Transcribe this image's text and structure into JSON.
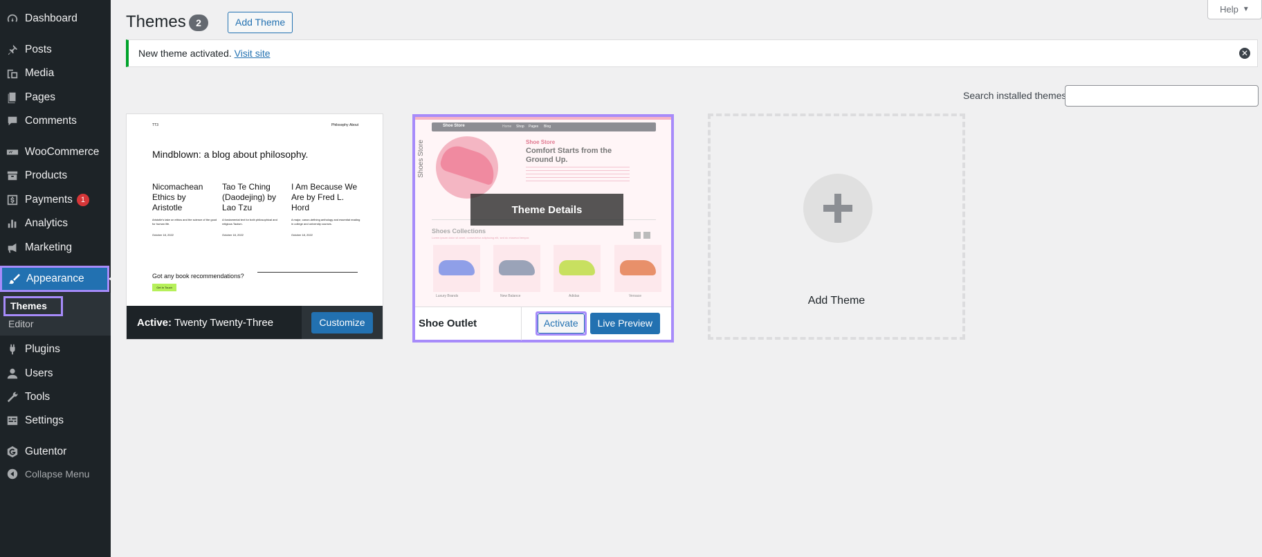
{
  "sidebar": {
    "items": [
      {
        "label": "Dashboard",
        "icon": "dashboard-icon"
      },
      {
        "label": "Posts",
        "icon": "pin-icon"
      },
      {
        "label": "Media",
        "icon": "media-icon"
      },
      {
        "label": "Pages",
        "icon": "pages-icon"
      },
      {
        "label": "Comments",
        "icon": "comment-icon"
      },
      {
        "label": "WooCommerce",
        "icon": "woo-icon"
      },
      {
        "label": "Products",
        "icon": "archive-icon"
      },
      {
        "label": "Payments",
        "icon": "dollar-icon",
        "badge": "1"
      },
      {
        "label": "Analytics",
        "icon": "bar-chart-icon"
      },
      {
        "label": "Marketing",
        "icon": "megaphone-icon"
      },
      {
        "label": "Appearance",
        "icon": "brush-icon"
      },
      {
        "label": "Plugins",
        "icon": "plug-icon"
      },
      {
        "label": "Users",
        "icon": "user-icon"
      },
      {
        "label": "Tools",
        "icon": "wrench-icon"
      },
      {
        "label": "Settings",
        "icon": "settings-icon"
      },
      {
        "label": "Gutentor",
        "icon": "gutentor-icon"
      }
    ],
    "submenu": [
      "Themes",
      "Editor"
    ],
    "collapse_label": "Collapse Menu"
  },
  "header": {
    "title": "Themes",
    "count": "2",
    "add_theme_label": "Add Theme",
    "help_label": "Help"
  },
  "notice": {
    "text": "New theme activated.",
    "link": "Visit site"
  },
  "search": {
    "label": "Search installed themes",
    "value": ""
  },
  "themes": {
    "active": {
      "prefix": "Active:",
      "name": "Twenty Twenty-Three",
      "button": "Customize",
      "preview": {
        "logo": "TT3",
        "nav": [
          "Philosophy",
          "About"
        ],
        "headline": "Mindblown: a blog about philosophy.",
        "posts": [
          {
            "title": "Nicomachean Ethics by Aristotle",
            "text": "Aristotle's take on ethics and the science of the good for human life.",
            "date": "October 18, 2022"
          },
          {
            "title": "Tao Te Ching (Daodejing) by Lao Tzu",
            "text": "A fundamental text for both philosophical and religious Taoism.",
            "date": "October 18, 2022"
          },
          {
            "title": "I Am Because We Are by Fred L. Hord",
            "text": "A major, canon-defining anthology and essential reading in college and university courses.",
            "date": "October 18, 2022"
          }
        ],
        "cta": "Got any book recommendations?",
        "cta_button": "Get In Touch"
      }
    },
    "shoe": {
      "name": "Shoe Outlet",
      "details": "Theme Details",
      "activate": "Activate",
      "preview_btn": "Live Preview",
      "preview": {
        "brand": "Shoe Store",
        "nav": [
          "Home",
          "Shop",
          "Pages",
          "Blog"
        ],
        "eyebrow": "Shoe Store",
        "headline": "Comfort Starts from the Ground Up.",
        "vertical": "Shoes Store",
        "collections": "Shoes Collections",
        "collections_sub": "Lorem ipsum dolor sit amet, consectetur adipiscing elit, sed do eiusmod tempor.",
        "products": [
          {
            "name": "Luxury Brands",
            "sub": "Product 02",
            "color": "#8f9fe8"
          },
          {
            "name": "New Balance",
            "sub": "Product 02",
            "color": "#9aa3b8"
          },
          {
            "name": "Adidas",
            "sub": "Product 02",
            "color": "#c8e060"
          },
          {
            "name": "Versace",
            "sub": "Product 02",
            "color": "#e8906a"
          }
        ]
      }
    },
    "add": {
      "label": "Add Theme"
    }
  }
}
